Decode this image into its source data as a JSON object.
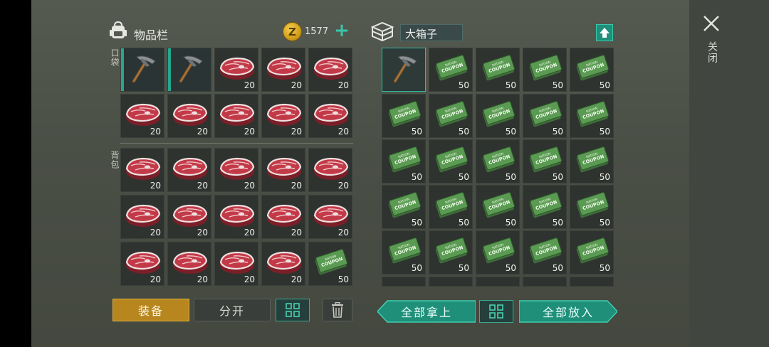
{
  "inventory": {
    "title": "物品栏",
    "pocket_label": "口袋",
    "backpack_label": "背包",
    "coins": "1577",
    "coin_symbol": "Z",
    "add_symbol": "+",
    "slots": [
      {
        "item": "pickaxe",
        "qty": "",
        "equipped": true
      },
      {
        "item": "pickaxe",
        "qty": "",
        "equipped": true
      },
      {
        "item": "raw-meat",
        "qty": "20"
      },
      {
        "item": "raw-meat",
        "qty": "20"
      },
      {
        "item": "raw-meat",
        "qty": "20"
      },
      {
        "item": "raw-meat",
        "qty": "20"
      },
      {
        "item": "raw-meat",
        "qty": "20"
      },
      {
        "item": "raw-meat",
        "qty": "20"
      },
      {
        "item": "raw-meat",
        "qty": "20"
      },
      {
        "item": "raw-meat",
        "qty": "20"
      },
      {
        "item": "raw-meat",
        "qty": "20"
      },
      {
        "item": "raw-meat",
        "qty": "20"
      },
      {
        "item": "raw-meat",
        "qty": "20"
      },
      {
        "item": "raw-meat",
        "qty": "20"
      },
      {
        "item": "raw-meat",
        "qty": "20"
      },
      {
        "item": "raw-meat",
        "qty": "20"
      },
      {
        "item": "raw-meat",
        "qty": "20"
      },
      {
        "item": "raw-meat",
        "qty": "20"
      },
      {
        "item": "raw-meat",
        "qty": "20"
      },
      {
        "item": "raw-meat",
        "qty": "20"
      },
      {
        "item": "raw-meat",
        "qty": "20"
      },
      {
        "item": "raw-meat",
        "qty": "20"
      },
      {
        "item": "raw-meat",
        "qty": "20"
      },
      {
        "item": "raw-meat",
        "qty": "20"
      },
      {
        "item": "ration-coupon",
        "qty": "50"
      }
    ]
  },
  "chest": {
    "name": "大箱子",
    "slots": [
      {
        "item": "pickaxe",
        "qty": "",
        "selected": true
      },
      {
        "item": "ration-coupon",
        "qty": "50"
      },
      {
        "item": "ration-coupon",
        "qty": "50"
      },
      {
        "item": "ration-coupon",
        "qty": "50"
      },
      {
        "item": "ration-coupon",
        "qty": "50"
      },
      {
        "item": "ration-coupon",
        "qty": "50"
      },
      {
        "item": "ration-coupon",
        "qty": "50"
      },
      {
        "item": "ration-coupon",
        "qty": "50"
      },
      {
        "item": "ration-coupon",
        "qty": "50"
      },
      {
        "item": "ration-coupon",
        "qty": "50"
      },
      {
        "item": "ration-coupon",
        "qty": "50"
      },
      {
        "item": "ration-coupon",
        "qty": "50"
      },
      {
        "item": "ration-coupon",
        "qty": "50"
      },
      {
        "item": "ration-coupon",
        "qty": "50"
      },
      {
        "item": "ration-coupon",
        "qty": "50"
      },
      {
        "item": "ration-coupon",
        "qty": "50"
      },
      {
        "item": "ration-coupon",
        "qty": "50"
      },
      {
        "item": "ration-coupon",
        "qty": "50"
      },
      {
        "item": "ration-coupon",
        "qty": "50"
      },
      {
        "item": "ration-coupon",
        "qty": "50"
      },
      {
        "item": "ration-coupon",
        "qty": "50"
      },
      {
        "item": "ration-coupon",
        "qty": "50"
      },
      {
        "item": "ration-coupon",
        "qty": "50"
      },
      {
        "item": "ration-coupon",
        "qty": "50"
      },
      {
        "item": "ration-coupon",
        "qty": "50"
      }
    ]
  },
  "coupon_text": {
    "line1": "RATION",
    "line2": "COUPON"
  },
  "buttons": {
    "equip": "装备",
    "split": "分开",
    "take_all": "全部拿上",
    "put_all": "全部放入",
    "close": "关闭"
  },
  "colors": {
    "accent": "#2fb99d",
    "equip": "#b8861e",
    "meat": "#b03040",
    "coupon": "#4f8a4a"
  }
}
